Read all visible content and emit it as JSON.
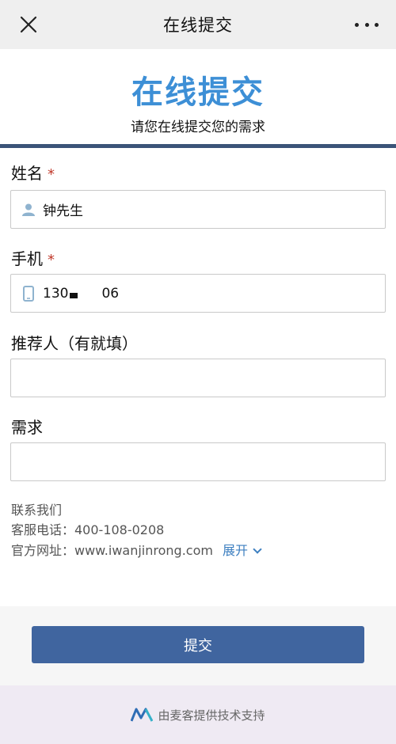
{
  "navbar": {
    "title": "在线提交",
    "close_icon": "close-icon",
    "more_icon": "more-icon"
  },
  "header": {
    "title": "在线提交",
    "subtitle": "请您在线提交您的需求",
    "rule_color": "#3b5478",
    "title_color": "#3d8fd6"
  },
  "form": {
    "name": {
      "label": "姓名",
      "required": "*",
      "value": "钟先生",
      "icon": "user-icon"
    },
    "phone": {
      "label": "手机",
      "required": "*",
      "value_prefix": "130",
      "value_suffix": "06",
      "icon": "phone-icon"
    },
    "referrer": {
      "label": "推荐人（有就填）",
      "value": ""
    },
    "request": {
      "label": "需求",
      "value": ""
    }
  },
  "contact": {
    "heading": "联系我们",
    "phone_line": "客服电话：400-108-0208",
    "site_line": "官方网址：www.iwanjinrong.com",
    "expand": "展开"
  },
  "submit": {
    "label": "提交",
    "color": "#40659f"
  },
  "footer": {
    "text": "由麦客提供技术支持",
    "logo_icon": "maike-logo-icon"
  }
}
